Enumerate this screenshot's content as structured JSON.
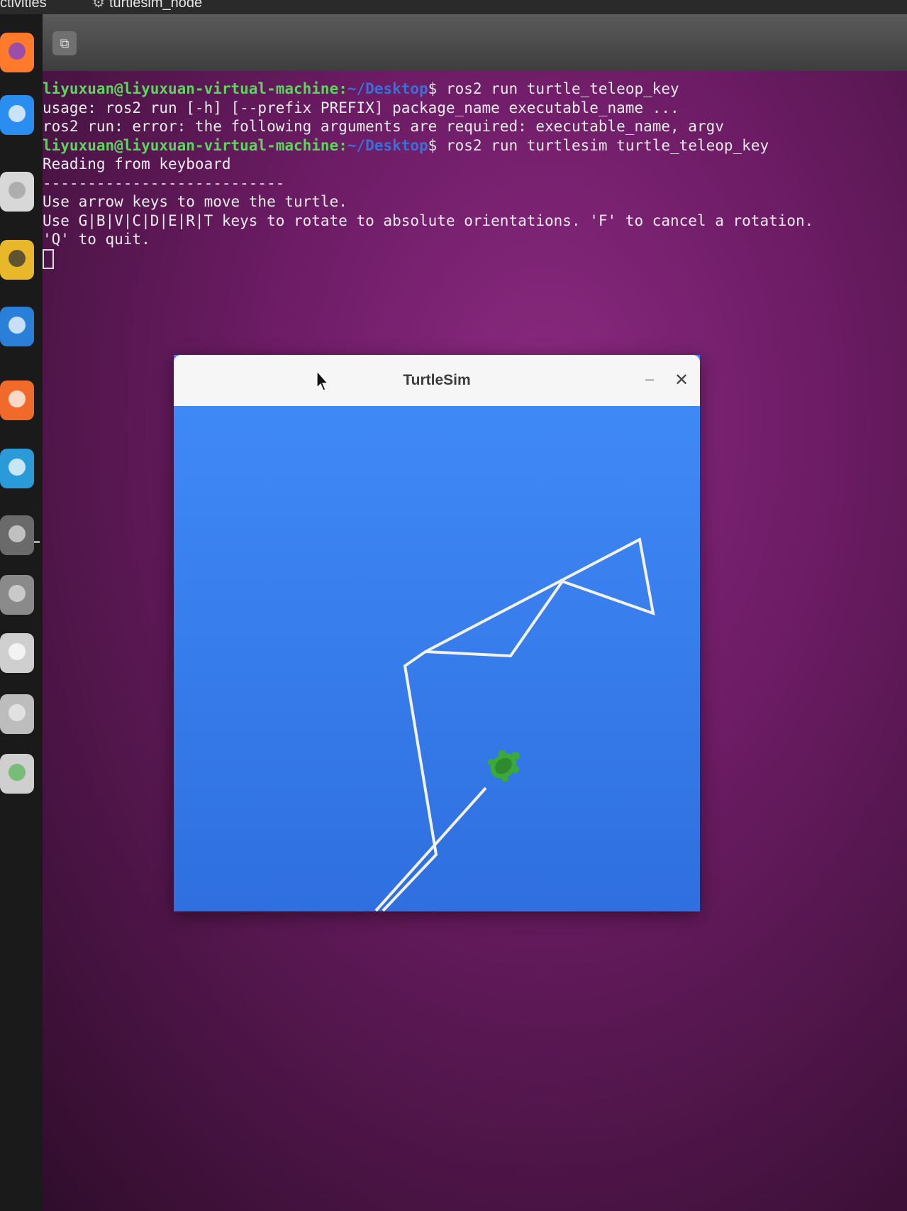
{
  "topbar": {
    "activities": "ctivities",
    "app_name": "turtlesim_node"
  },
  "dock": {
    "items": [
      {
        "name": "firefox-icon",
        "color": "#ff7a2a",
        "accent": "#7b3fd6"
      },
      {
        "name": "thunderbird-icon",
        "color": "#2a8ef0",
        "accent": "#ffffff"
      },
      {
        "name": "files-icon",
        "color": "#d8d8d8",
        "accent": "#a0a0a0"
      },
      {
        "name": "rhythmbox-icon",
        "color": "#e8b82a",
        "accent": "#333333"
      },
      {
        "name": "libreoffice-writer-icon",
        "color": "#2a7fd8",
        "accent": "#ffffff"
      },
      {
        "name": "software-center-icon",
        "color": "#f06a2a",
        "accent": "#ffffff"
      },
      {
        "name": "help-icon",
        "color": "#2a9ad8",
        "accent": "#ffffff"
      },
      {
        "name": "terminal-icon",
        "color": "#6a6a6a",
        "accent": "#dddddd"
      },
      {
        "name": "settings-icon",
        "color": "#8a8a8a",
        "accent": "#dddddd"
      },
      {
        "name": "disc-icon",
        "color": "#cfcfcf",
        "accent": "#ffffff"
      },
      {
        "name": "save-icon",
        "color": "#bdbdbd",
        "accent": "#eeeeee"
      },
      {
        "name": "trash-icon",
        "color": "#cfcfcf",
        "accent": "#5ab55a"
      }
    ]
  },
  "terminal": {
    "tab_icon": "⧉",
    "lines": [
      {
        "type": "prompt",
        "user": "liyuxuan@liyuxuan-virtual-machine:",
        "path": "~/Desktop",
        "cmd": "$ ros2 run turtle_teleop_key"
      },
      {
        "type": "text",
        "text": "usage: ros2 run [-h] [--prefix PREFIX] package_name executable_name ..."
      },
      {
        "type": "text",
        "text": "ros2 run: error: the following arguments are required: executable_name, argv"
      },
      {
        "type": "prompt",
        "user": "liyuxuan@liyuxuan-virtual-machine:",
        "path": "~/Desktop",
        "cmd": "$ ros2 run turtlesim turtle_teleop_key"
      },
      {
        "type": "text",
        "text": "Reading from keyboard"
      },
      {
        "type": "text",
        "text": "---------------------------"
      },
      {
        "type": "text",
        "text": "Use arrow keys to move the turtle."
      },
      {
        "type": "text",
        "text": "Use G|B|V|C|D|E|R|T keys to rotate to absolute orientations. 'F' to cancel a rotation."
      },
      {
        "type": "text",
        "text": "'Q' to quit."
      }
    ]
  },
  "turtlesim": {
    "title": "TurtleSim",
    "minimize": "–",
    "close": "✕",
    "background_color": "#3a82f0",
    "pen_color": "#f2f2f2",
    "turtle_color": "#3aa83a"
  }
}
